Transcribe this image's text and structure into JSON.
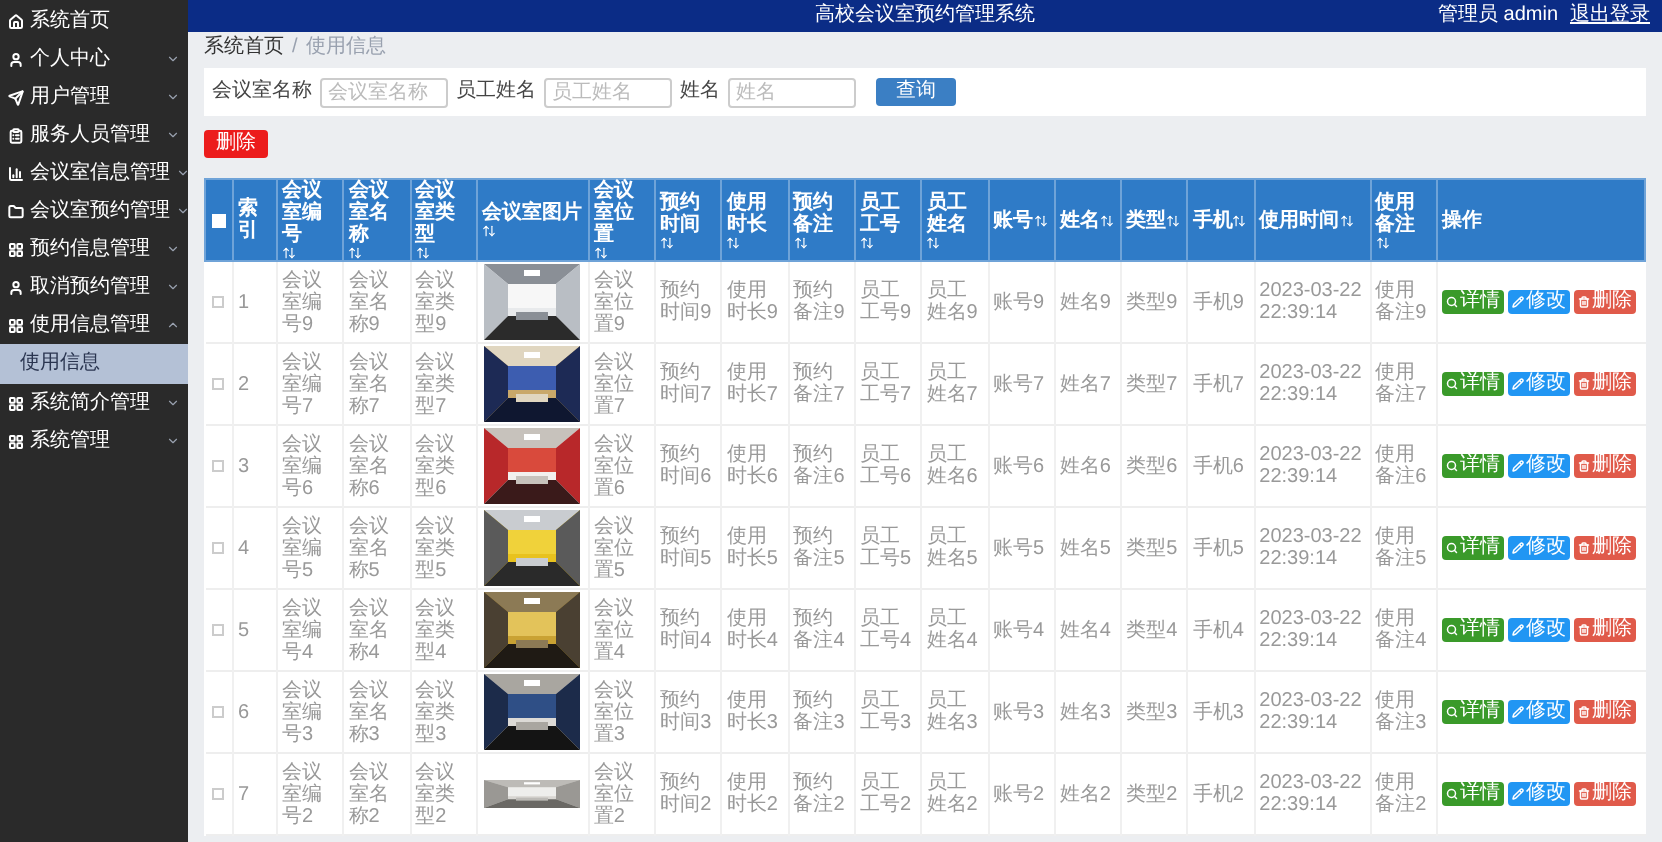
{
  "sidebar": {
    "items": [
      {
        "label": "系统首页"
      },
      {
        "label": "个人中心",
        "expanded": false
      },
      {
        "label": "用户管理",
        "expanded": false
      },
      {
        "label": "服务人员管理",
        "expanded": false
      },
      {
        "label": "会议室信息管理",
        "expanded": false
      },
      {
        "label": "会议室预约管理",
        "expanded": false
      },
      {
        "label": "预约信息管理",
        "expanded": false
      },
      {
        "label": "取消预约管理",
        "expanded": false
      },
      {
        "label": "使用信息管理",
        "expanded": true,
        "children": [
          {
            "label": "使用信息",
            "selected": true
          }
        ]
      },
      {
        "label": "系统简介管理",
        "expanded": false
      },
      {
        "label": "系统管理",
        "expanded": false
      }
    ]
  },
  "header": {
    "title": "高校会议室预约管理系统",
    "user": "管理员 admin",
    "logout": "退出登录"
  },
  "breadcrumb": {
    "items": [
      "系统首页",
      "使用信息"
    ],
    "separator": "/"
  },
  "search": {
    "fields": [
      {
        "label": "会议室名称",
        "placeholder": "会议室名称"
      },
      {
        "label": "员工姓名",
        "placeholder": "员工姓名"
      },
      {
        "label": "姓名",
        "placeholder": "姓名"
      }
    ],
    "button": "查询"
  },
  "delete_button": "删除",
  "table": {
    "select_all_checked": false,
    "columns": [
      {
        "kind": "text",
        "label": "索引",
        "sortable": false
      },
      {
        "kind": "text",
        "label": "会议室编号",
        "sortable": true
      },
      {
        "kind": "text",
        "label": "会议室名称",
        "sortable": true
      },
      {
        "kind": "text",
        "label": "会议室类型",
        "sortable": true
      },
      {
        "label": "会议室图片",
        "sortable": true
      },
      {
        "kind": "text",
        "label": "会议室位置",
        "sortable": true
      },
      {
        "kind": "text",
        "label": "预约时间",
        "sortable": true
      },
      {
        "kind": "text",
        "label": "使用时长",
        "sortable": true
      },
      {
        "kind": "text",
        "label": "预约备注",
        "sortable": true
      },
      {
        "kind": "text",
        "label": "员工工号",
        "sortable": true
      },
      {
        "kind": "text",
        "label": "员工姓名",
        "sortable": true
      },
      {
        "kind": "text",
        "label": "账号",
        "sortable": true
      },
      {
        "kind": "text",
        "label": "姓名",
        "sortable": true
      },
      {
        "kind": "text",
        "label": "类型",
        "sortable": true
      },
      {
        "kind": "text",
        "label": "手机",
        "sortable": true
      },
      {
        "kind": "date",
        "label": "使用时间",
        "sortable": true
      },
      {
        "kind": "text",
        "label": "使用备注",
        "sortable": true
      },
      {
        "kind": "actions",
        "label": "操作",
        "sortable": false
      }
    ],
    "rows": [
      {
        "checked": false,
        "values": [
          "1",
          "会议室编号9",
          "会议室名称9",
          "会议室类型9",
          "会议室位置9",
          "预约时间9",
          "使用时长9",
          "预约备注9",
          "员工工号9",
          "员工姓名9",
          "账号9",
          "姓名9",
          "类型9",
          "手机9",
          "2023-03-22 22:39:14",
          "使用备注9"
        ],
        "actions": [
          {
            "kind": "view",
            "label": "详情"
          },
          {
            "kind": "edit",
            "label": "修改"
          },
          {
            "kind": "delete",
            "label": "删除"
          }
        ]
      },
      {
        "checked": false,
        "values": [
          "2",
          "会议室编号7",
          "会议室名称7",
          "会议室类型7",
          "会议室位置7",
          "预约时间7",
          "使用时长7",
          "预约备注7",
          "员工工号7",
          "员工姓名7",
          "账号7",
          "姓名7",
          "类型7",
          "手机7",
          "2023-03-22 22:39:14",
          "使用备注7"
        ],
        "actions": [
          {
            "kind": "view",
            "label": "详情"
          },
          {
            "kind": "edit",
            "label": "修改"
          },
          {
            "kind": "delete",
            "label": "删除"
          }
        ]
      },
      {
        "checked": false,
        "values": [
          "3",
          "会议室编号6",
          "会议室名称6",
          "会议室类型6",
          "会议室位置6",
          "预约时间6",
          "使用时长6",
          "预约备注6",
          "员工工号6",
          "员工姓名6",
          "账号6",
          "姓名6",
          "类型6",
          "手机6",
          "2023-03-22 22:39:14",
          "使用备注6"
        ],
        "actions": [
          {
            "kind": "view",
            "label": "详情"
          },
          {
            "kind": "edit",
            "label": "修改"
          },
          {
            "kind": "delete",
            "label": "删除"
          }
        ]
      },
      {
        "checked": false,
        "values": [
          "4",
          "会议室编号5",
          "会议室名称5",
          "会议室类型5",
          "会议室位置5",
          "预约时间5",
          "使用时长5",
          "预约备注5",
          "员工工号5",
          "员工姓名5",
          "账号5",
          "姓名5",
          "类型5",
          "手机5",
          "2023-03-22 22:39:14",
          "使用备注5"
        ],
        "actions": [
          {
            "kind": "view",
            "label": "详情"
          },
          {
            "kind": "edit",
            "label": "修改"
          },
          {
            "kind": "delete",
            "label": "删除"
          }
        ]
      },
      {
        "checked": false,
        "values": [
          "5",
          "会议室编号4",
          "会议室名称4",
          "会议室类型4",
          "会议室位置4",
          "预约时间4",
          "使用时长4",
          "预约备注4",
          "员工工号4",
          "员工姓名4",
          "账号4",
          "姓名4",
          "类型4",
          "手机4",
          "2023-03-22 22:39:14",
          "使用备注4"
        ],
        "actions": [
          {
            "kind": "view",
            "label": "详情"
          },
          {
            "kind": "edit",
            "label": "修改"
          },
          {
            "kind": "delete",
            "label": "删除"
          }
        ]
      },
      {
        "checked": false,
        "values": [
          "6",
          "会议室编号3",
          "会议室名称3",
          "会议室类型3",
          "会议室位置3",
          "预约时间3",
          "使用时长3",
          "预约备注3",
          "员工工号3",
          "员工姓名3",
          "账号3",
          "姓名3",
          "类型3",
          "手机3",
          "2023-03-22 22:39:14",
          "使用备注3"
        ],
        "actions": [
          {
            "kind": "view",
            "label": "详情"
          },
          {
            "kind": "edit",
            "label": "修改"
          },
          {
            "kind": "delete",
            "label": "删除"
          }
        ]
      },
      {
        "checked": false,
        "values": [
          "7",
          "会议室编号2",
          "会议室名称2",
          "会议室类型2",
          "会议室位置2",
          "预约时间2",
          "使用时长2",
          "预约备注2",
          "员工工号2",
          "员工姓名2",
          "账号2",
          "姓名2",
          "类型2",
          "手机2",
          "2023-03-22 22:39:14",
          "使用备注2"
        ],
        "actions": [
          {
            "kind": "view",
            "label": "详情"
          },
          {
            "kind": "edit",
            "label": "修改"
          },
          {
            "kind": "delete",
            "label": "删除"
          }
        ]
      }
    ]
  }
}
